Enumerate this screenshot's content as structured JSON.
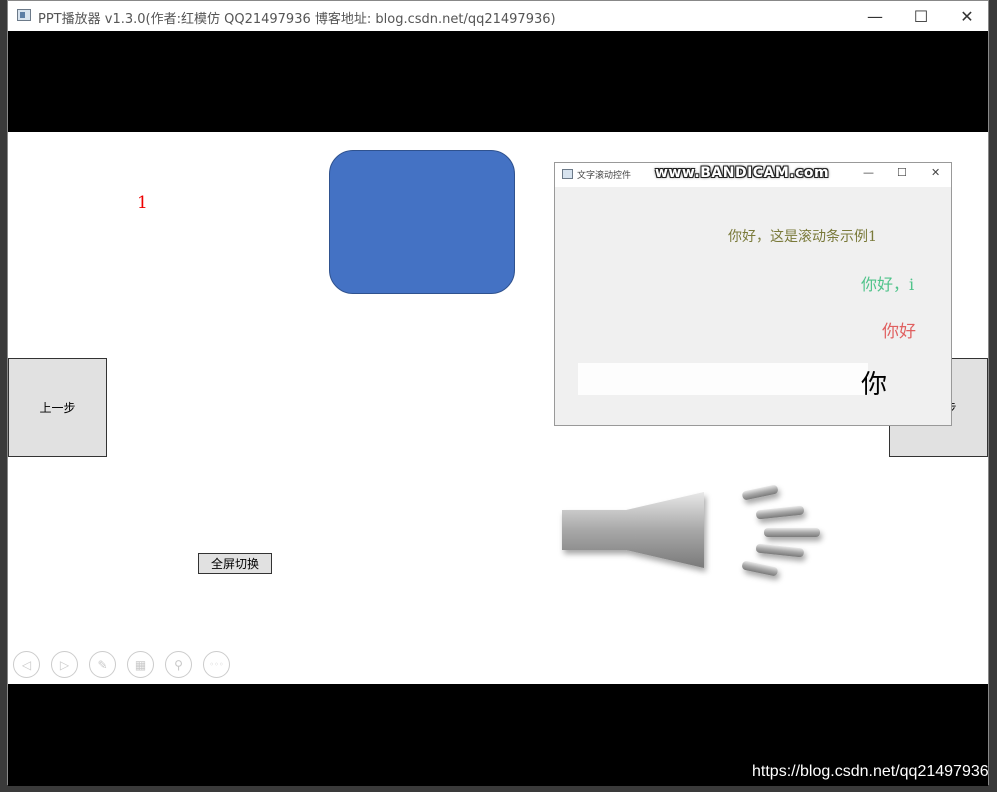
{
  "window": {
    "title": "PPT播放器  v1.3.0(作者:红模仿 QQ21497936 博客地址: blog.csdn.net/qq21497936)",
    "minimize_glyph": "—",
    "maximize_glyph": "☐",
    "close_glyph": "✕"
  },
  "slide": {
    "page_number": "1",
    "shape_color": "#4472c4",
    "prev_label": "上一步",
    "next_label": "下一步",
    "fullscreen_label": "全屏切换"
  },
  "toolbar": {
    "icons": [
      "prev-icon",
      "next-icon",
      "pen-icon",
      "slides-icon",
      "zoom-icon",
      "more-icon"
    ],
    "glyphs": [
      "◁",
      "▷",
      "✎",
      "▦",
      "⚲",
      "◦◦◦"
    ]
  },
  "child_window": {
    "title": "文字滚动控件",
    "watermark": "www.BANDICAM.com",
    "minimize_glyph": "—",
    "maximize_glyph": "☐",
    "close_glyph": "✕",
    "line1": "你好，这是滚动条示例1",
    "line1_color": "#7a7a3a",
    "line2": "你好，i",
    "line2_color": "#4fc38a",
    "line3": "你好",
    "line3_color": "#e06060",
    "line4": "你"
  },
  "footer": {
    "blog_url": "https://blog.csdn.net/qq21497936"
  }
}
